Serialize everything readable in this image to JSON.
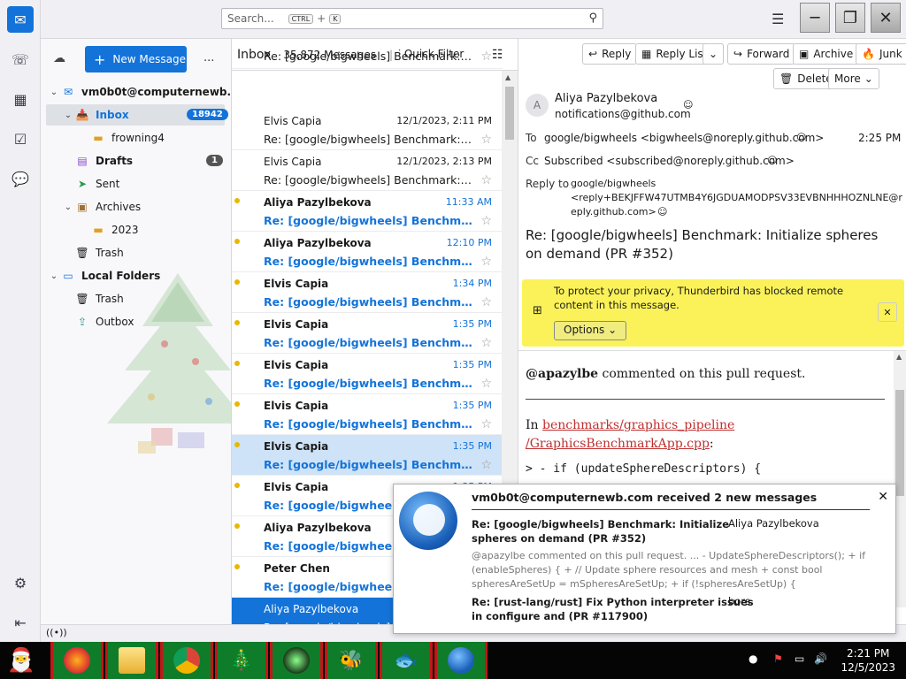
{
  "titlebar": {
    "search_placeholder": "Search...",
    "kbd_ctrl": "CTRL",
    "kbd_plus": "+",
    "kbd_k": "K"
  },
  "folders": {
    "new_message": "New Message",
    "more": "...",
    "account": "vm0b0t@computernewb...",
    "inbox": "Inbox",
    "inbox_count": "18942",
    "frowning": "frowning4",
    "drafts": "Drafts",
    "drafts_count": "1",
    "sent": "Sent",
    "archives": "Archives",
    "year": "2023",
    "trash": "Trash",
    "local_folders": "Local Folders",
    "local_trash": "Trash",
    "outbox": "Outbox"
  },
  "threads": {
    "folder": "Inbox",
    "count": "35,872 Messages",
    "quick_filter": "Quick Filter",
    "rows": [
      {
        "from": "",
        "date": "",
        "subject": "Re: [google/bigwheels] Benchmark: Initi..."
      },
      {
        "from": "Elvis Capia",
        "date": "12/1/2023, 2:11 PM",
        "subject": "Re: [google/bigwheels] Benchmark: Initi..."
      },
      {
        "from": "Elvis Capia",
        "date": "12/1/2023, 2:13 PM",
        "subject": "Re: [google/bigwheels] Benchmark: Initi..."
      },
      {
        "from": "Aliya Pazylbekova",
        "date": "11:33 AM",
        "subject": "Re: [google/bigwheels] Benchmark:..."
      },
      {
        "from": "Aliya Pazylbekova",
        "date": "12:10 PM",
        "subject": "Re: [google/bigwheels] Benchmark:..."
      },
      {
        "from": "Elvis Capia",
        "date": "1:34 PM",
        "subject": "Re: [google/bigwheels] Benchmark:..."
      },
      {
        "from": "Elvis Capia",
        "date": "1:35 PM",
        "subject": "Re: [google/bigwheels] Benchmark:..."
      },
      {
        "from": "Elvis Capia",
        "date": "1:35 PM",
        "subject": "Re: [google/bigwheels] Benchmark:..."
      },
      {
        "from": "Elvis Capia",
        "date": "1:35 PM",
        "subject": "Re: [google/bigwheels] Benchmark:..."
      },
      {
        "from": "Elvis Capia",
        "date": "1:35 PM",
        "subject": "Re: [google/bigwheels] Benchmark:..."
      },
      {
        "from": "Elvis Capia",
        "date": "1:35 PM",
        "subject": "Re: [google/bigwheels] Benchmark:..."
      },
      {
        "from": "Aliya Pazylbekova",
        "date": "",
        "subject": "Re: [google/bigwheels] Benchmark:..."
      },
      {
        "from": "Peter Chen",
        "date": "",
        "subject": "Re: [google/bigwheels] Benchmark:..."
      },
      {
        "from": "Aliya Pazylbekova",
        "date": "",
        "subject": "Re: [google/bigwheels] Benchmark:..."
      }
    ]
  },
  "message": {
    "reply": "Reply",
    "reply_list": "Reply List",
    "forward": "Forward",
    "archive": "Archive",
    "junk": "Junk",
    "delete": "Delete",
    "more": "More",
    "sender_initial": "A",
    "sender_name": "Aliya Pazylbekova",
    "sender_email": "notifications@github.com",
    "to_label": "To",
    "to_value": "google/bigwheels <bigwheels@noreply.github.com>",
    "time": "2:25 PM",
    "cc_label": "Cc",
    "cc_value": "Subscribed <subscribed@noreply.github.com>",
    "replyto_label": "Reply to",
    "replyto_1": "google/bigwheels",
    "replyto_2": "<reply+BEKJFFW47UTMB4Y6JGDUAMODPSV33EVBNHHHOZNLNE@r",
    "replyto_3": "eply.github.com>",
    "subject": "Re: [google/bigwheels] Benchmark: Initialize spheres on demand (PR #352)",
    "privacy_1": "To protect your privacy, Thunderbird has blocked remote",
    "privacy_2": "content in this message.",
    "options": "Options",
    "commenter": "@apazylbe",
    "commented": " commented on this pull request.",
    "in_word": "In ",
    "file_1": "benchmarks/graphics_pipeline",
    "file_2": "/GraphicsBenchmarkApp.cpp",
    "colon": ":",
    "code": "> -    if (updateSphereDescriptors) {"
  },
  "notification": {
    "title": "vm0b0t@computernewb.com received 2 new messages",
    "msg1_subject_1": "Re: [google/bigwheels] Benchmark: Initialize",
    "msg1_subject_2": "spheres on demand (PR #352)",
    "msg1_from": "Aliya Pazylbekova",
    "msg1_preview_1": "@apazylbe commented on this pull request. ... - UpdateSphereDescriptors(); + if",
    "msg1_preview_2": "(enableSpheres) { + // Update sphere resources and mesh + const bool",
    "msg1_preview_3": "spheresAreSetUp = mSpheresAreSetUp; + if (!spheresAreSetUp) {",
    "msg2_subject_1": "Re: [rust-lang/rust] Fix Python interpreter issues",
    "msg2_subject_2": "in configure and (PR #117900)",
    "msg2_from": "bors"
  },
  "taskbar": {
    "time": "2:21 PM",
    "date": "12/5/2023"
  },
  "colors": {
    "accent": "#1373d9",
    "privacy_bar": "#fbf25a",
    "taskbar_green": "#0f7c2a",
    "taskbar_red": "#c01818"
  }
}
